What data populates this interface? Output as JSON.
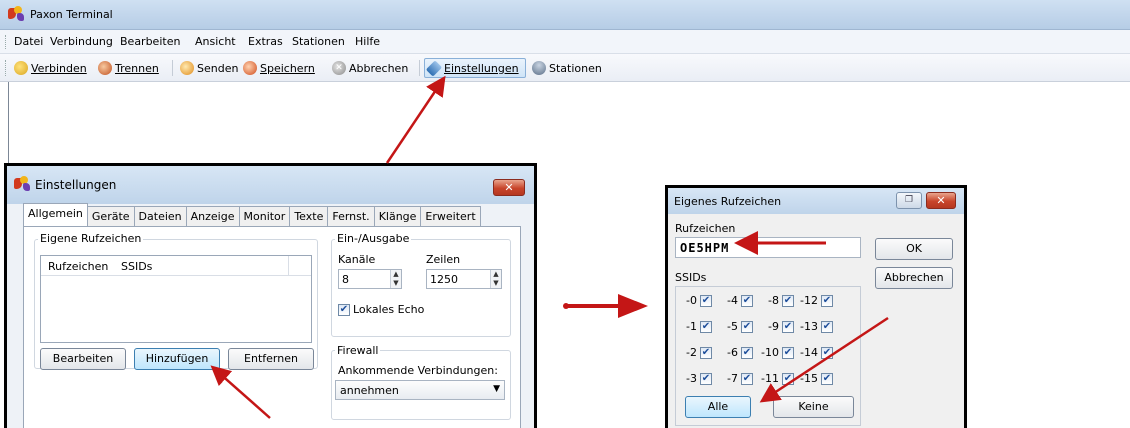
{
  "app": {
    "title": "Paxon Terminal"
  },
  "menu": [
    "Datei",
    "Verbindung",
    "Bearbeiten",
    "Ansicht",
    "Extras",
    "Stationen",
    "Hilfe"
  ],
  "toolbar": {
    "connect": "Verbinden",
    "disconnect": "Trennen",
    "send": "Senden",
    "save": "Speichern",
    "abort": "Abbrechen",
    "settings": "Einstellungen",
    "stations": "Stationen"
  },
  "settings_dialog": {
    "title": "Einstellungen",
    "close": "✕",
    "tabs": [
      "Allgemein",
      "Geräte",
      "Dateien",
      "Anzeige",
      "Monitor",
      "Texte",
      "Fernst.",
      "Klänge",
      "Erweitert"
    ],
    "callsigns_group": "Eigene Rufzeichen",
    "columns": [
      "Rufzeichen",
      "SSIDs"
    ],
    "edit": "Bearbeiten",
    "add": "Hinzufügen",
    "remove": "Entfernen",
    "io_group": "Ein-/Ausgabe",
    "channels_label": "Kanäle",
    "channels_value": "8",
    "lines_label": "Zeilen",
    "lines_value": "1250",
    "local_echo": "Lokales Echo",
    "firewall_group": "Firewall",
    "incoming_label": "Ankommende Verbindungen:",
    "incoming_value": "annehmen"
  },
  "callsign_dialog": {
    "title": "Eigenes Rufzeichen",
    "callsign_label": "Rufzeichen",
    "callsign_value": "OE5HPM",
    "ok": "OK",
    "cancel": "Abbrechen",
    "ssids_label": "SSIDs",
    "ssids": [
      [
        "-0",
        "-4",
        "-8",
        "-12"
      ],
      [
        "-1",
        "-5",
        "-9",
        "-13"
      ],
      [
        "-2",
        "-6",
        "-10",
        "-14"
      ],
      [
        "-3",
        "-7",
        "-11",
        "-15"
      ]
    ],
    "all": "Alle",
    "none": "Keine"
  },
  "colors": {
    "arrow": "#c41616",
    "title_bg": "#c6d9ee",
    "close_red": "#c8452b"
  }
}
